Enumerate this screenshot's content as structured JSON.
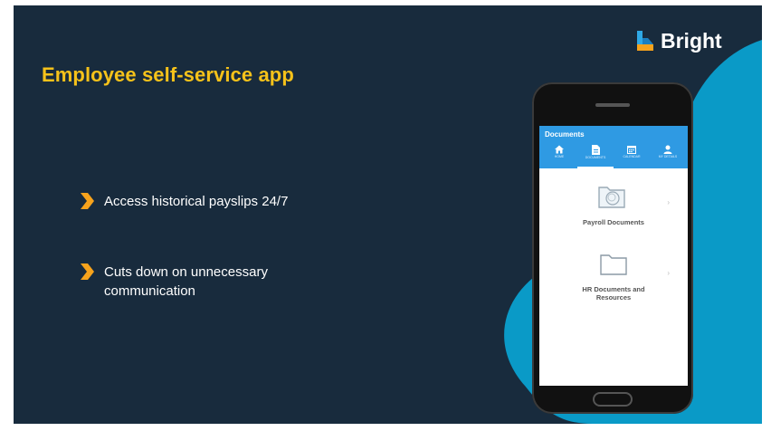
{
  "slide": {
    "title": "Employee self-service app",
    "logo_text": "Bright",
    "bullets": [
      {
        "text": "Access historical payslips 24/7"
      },
      {
        "text": "Cuts down on unnecessary communication"
      }
    ]
  },
  "app": {
    "header_title": "Documents",
    "tabs": [
      {
        "label": "HOME",
        "icon": "home-icon"
      },
      {
        "label": "DOCUMENTS",
        "icon": "document-icon",
        "active": true
      },
      {
        "label": "CALENDAR",
        "icon": "calendar-icon"
      },
      {
        "label": "MY DETAILS",
        "icon": "person-icon"
      }
    ],
    "items": [
      {
        "label": "Payroll Documents",
        "icon": "folder-icon"
      },
      {
        "label": "HR Documents and Resources",
        "icon": "folder-icon"
      }
    ]
  },
  "colors": {
    "background": "#182b3d",
    "title": "#f6c21a",
    "accent_blob": "#0a9ac7",
    "app_bar": "#2f9ae3",
    "chevron": "#f7a31c"
  }
}
